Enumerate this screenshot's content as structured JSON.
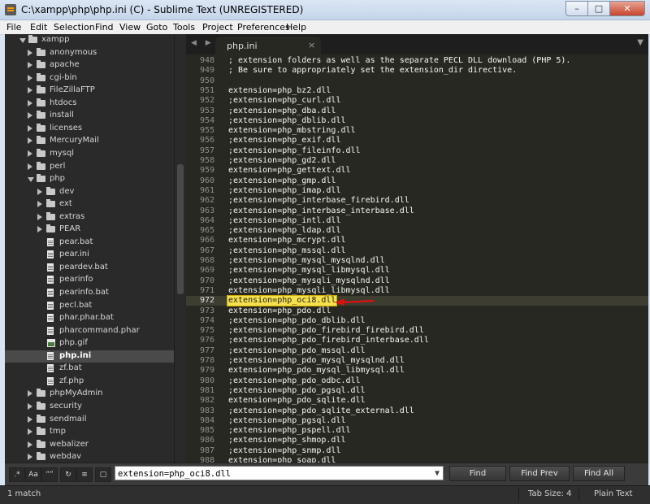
{
  "window": {
    "title": "C:\\xampp\\php\\php.ini (C) - Sublime Text (UNREGISTERED)",
    "buttons": {
      "minimize": "–",
      "maximize": "□",
      "close": "✕"
    }
  },
  "menu": [
    "File",
    "Edit",
    "Selection",
    "Find",
    "View",
    "Goto",
    "Tools",
    "Project",
    "Preferences",
    "Help"
  ],
  "sidebar": {
    "items": [
      {
        "label": "xampp",
        "type": "folder",
        "open": true,
        "indent": 1
      },
      {
        "label": "anonymous",
        "type": "folder",
        "open": false,
        "indent": 2
      },
      {
        "label": "apache",
        "type": "folder",
        "open": false,
        "indent": 2
      },
      {
        "label": "cgi-bin",
        "type": "folder",
        "open": false,
        "indent": 2
      },
      {
        "label": "FileZillaFTP",
        "type": "folder",
        "open": false,
        "indent": 2
      },
      {
        "label": "htdocs",
        "type": "folder",
        "open": false,
        "indent": 2
      },
      {
        "label": "install",
        "type": "folder",
        "open": false,
        "indent": 2
      },
      {
        "label": "licenses",
        "type": "folder",
        "open": false,
        "indent": 2
      },
      {
        "label": "MercuryMail",
        "type": "folder",
        "open": false,
        "indent": 2
      },
      {
        "label": "mysql",
        "type": "folder",
        "open": false,
        "indent": 2
      },
      {
        "label": "perl",
        "type": "folder",
        "open": false,
        "indent": 2
      },
      {
        "label": "php",
        "type": "folder",
        "open": true,
        "indent": 2
      },
      {
        "label": "dev",
        "type": "folder",
        "open": false,
        "indent": 3
      },
      {
        "label": "ext",
        "type": "folder",
        "open": false,
        "indent": 3
      },
      {
        "label": "extras",
        "type": "folder",
        "open": false,
        "indent": 3
      },
      {
        "label": "PEAR",
        "type": "folder",
        "open": false,
        "indent": 3
      },
      {
        "label": "pear.bat",
        "type": "file",
        "indent": 3
      },
      {
        "label": "pear.ini",
        "type": "file",
        "indent": 3
      },
      {
        "label": "peardev.bat",
        "type": "file",
        "indent": 3
      },
      {
        "label": "pearinfo",
        "type": "file",
        "indent": 3
      },
      {
        "label": "pearinfo.bat",
        "type": "file",
        "indent": 3
      },
      {
        "label": "pecl.bat",
        "type": "file",
        "indent": 3
      },
      {
        "label": "phar.phar.bat",
        "type": "file",
        "indent": 3
      },
      {
        "label": "pharcommand.phar",
        "type": "file",
        "indent": 3
      },
      {
        "label": "php.gif",
        "type": "image",
        "indent": 3
      },
      {
        "label": "php.ini",
        "type": "file",
        "indent": 3,
        "selected": true
      },
      {
        "label": "zf.bat",
        "type": "file",
        "indent": 3
      },
      {
        "label": "zf.php",
        "type": "file",
        "indent": 3
      },
      {
        "label": "phpMyAdmin",
        "type": "folder",
        "open": false,
        "indent": 2
      },
      {
        "label": "security",
        "type": "folder",
        "open": false,
        "indent": 2
      },
      {
        "label": "sendmail",
        "type": "folder",
        "open": false,
        "indent": 2
      },
      {
        "label": "tmp",
        "type": "folder",
        "open": false,
        "indent": 2
      },
      {
        "label": "webalizer",
        "type": "folder",
        "open": false,
        "indent": 2
      },
      {
        "label": "webdav",
        "type": "folder",
        "open": false,
        "indent": 2
      }
    ]
  },
  "tab": {
    "label": "php.ini",
    "close": "×",
    "nav": "◀ ▶",
    "dropdown": "▼"
  },
  "editor": {
    "current_line": 972,
    "highlighted_line": 972,
    "lines": [
      {
        "n": "948",
        "t": "; extension folders as well as the separate PECL DLL download (PHP 5)."
      },
      {
        "n": "949",
        "t": "; Be sure to appropriately set the extension_dir directive."
      },
      {
        "n": "950",
        "t": ""
      },
      {
        "n": "951",
        "t": "extension=php_bz2.dll"
      },
      {
        "n": "952",
        "t": ";extension=php_curl.dll"
      },
      {
        "n": "953",
        "t": ";extension=php_dba.dll"
      },
      {
        "n": "954",
        "t": ";extension=php_dblib.dll"
      },
      {
        "n": "955",
        "t": "extension=php_mbstring.dll"
      },
      {
        "n": "956",
        "t": ";extension=php_exif.dll"
      },
      {
        "n": "957",
        "t": ";extension=php_fileinfo.dll"
      },
      {
        "n": "958",
        "t": ";extension=php_gd2.dll"
      },
      {
        "n": "959",
        "t": "extension=php_gettext.dll"
      },
      {
        "n": "960",
        "t": ";extension=php_gmp.dll"
      },
      {
        "n": "961",
        "t": ";extension=php_imap.dll"
      },
      {
        "n": "962",
        "t": ";extension=php_interbase_firebird.dll"
      },
      {
        "n": "963",
        "t": ";extension=php_interbase_interbase.dll"
      },
      {
        "n": "964",
        "t": ";extension=php_intl.dll"
      },
      {
        "n": "965",
        "t": ";extension=php_ldap.dll"
      },
      {
        "n": "966",
        "t": "extension=php_mcrypt.dll"
      },
      {
        "n": "967",
        "t": ";extension=php_mssql.dll"
      },
      {
        "n": "968",
        "t": ";extension=php_mysql_mysqlnd.dll"
      },
      {
        "n": "969",
        "t": ";extension=php_mysql_libmysql.dll"
      },
      {
        "n": "970",
        "t": ";extension=php_mysqli_mysqlnd.dll"
      },
      {
        "n": "971",
        "t": "extension=php_mysqli_libmysql.dll"
      },
      {
        "n": "972",
        "t": "extension=php_oci8.dll"
      },
      {
        "n": "973",
        "t": "extension=php_pdo.dll"
      },
      {
        "n": "974",
        "t": ";extension=php_pdo_dblib.dll"
      },
      {
        "n": "975",
        "t": ";extension=php_pdo_firebird_firebird.dll"
      },
      {
        "n": "976",
        "t": ";extension=php_pdo_firebird_interbase.dll"
      },
      {
        "n": "977",
        "t": ";extension=php_pdo_mssql.dll"
      },
      {
        "n": "978",
        "t": ";extension=php_pdo_mysql_mysqlnd.dll"
      },
      {
        "n": "979",
        "t": "extension=php_pdo_mysql_libmysql.dll"
      },
      {
        "n": "980",
        "t": ";extension=php_pdo_odbc.dll"
      },
      {
        "n": "981",
        "t": ";extension=php_pdo_pgsql.dll"
      },
      {
        "n": "982",
        "t": "extension=php_pdo_sqlite.dll"
      },
      {
        "n": "983",
        "t": ";extension=php_pdo_sqlite_external.dll"
      },
      {
        "n": "984",
        "t": ";extension=php_pgsql.dll"
      },
      {
        "n": "985",
        "t": ";extension=php_pspell.dll"
      },
      {
        "n": "986",
        "t": ";extension=php_shmop.dll"
      },
      {
        "n": "987",
        "t": ";extension=php_snmp.dll"
      },
      {
        "n": "988",
        "t": "extension=php_soap.dll"
      }
    ]
  },
  "find": {
    "options": [
      {
        "name": "regex-toggle",
        "label": ".*"
      },
      {
        "name": "case-toggle",
        "label": "Aa"
      },
      {
        "name": "whole-word-toggle",
        "label": "“”"
      },
      {
        "name": "wrap-toggle",
        "label": "↻"
      },
      {
        "name": "in-selection-toggle",
        "label": "≡"
      },
      {
        "name": "highlight-toggle",
        "label": "▢"
      }
    ],
    "value": "extension=php_oci8.dll",
    "dropdown": "▼",
    "find_label": "Find",
    "find_prev_label": "Find Prev",
    "find_all_label": "Find All"
  },
  "status": {
    "message": "1 match",
    "tab_size": "Tab Size: 4",
    "syntax": "Plain Text"
  },
  "colors": {
    "editor_bg": "#272822",
    "sidebar_bg": "#2a2a2a",
    "match_highlight": "#f5e14c",
    "arrow": "#e01010"
  }
}
